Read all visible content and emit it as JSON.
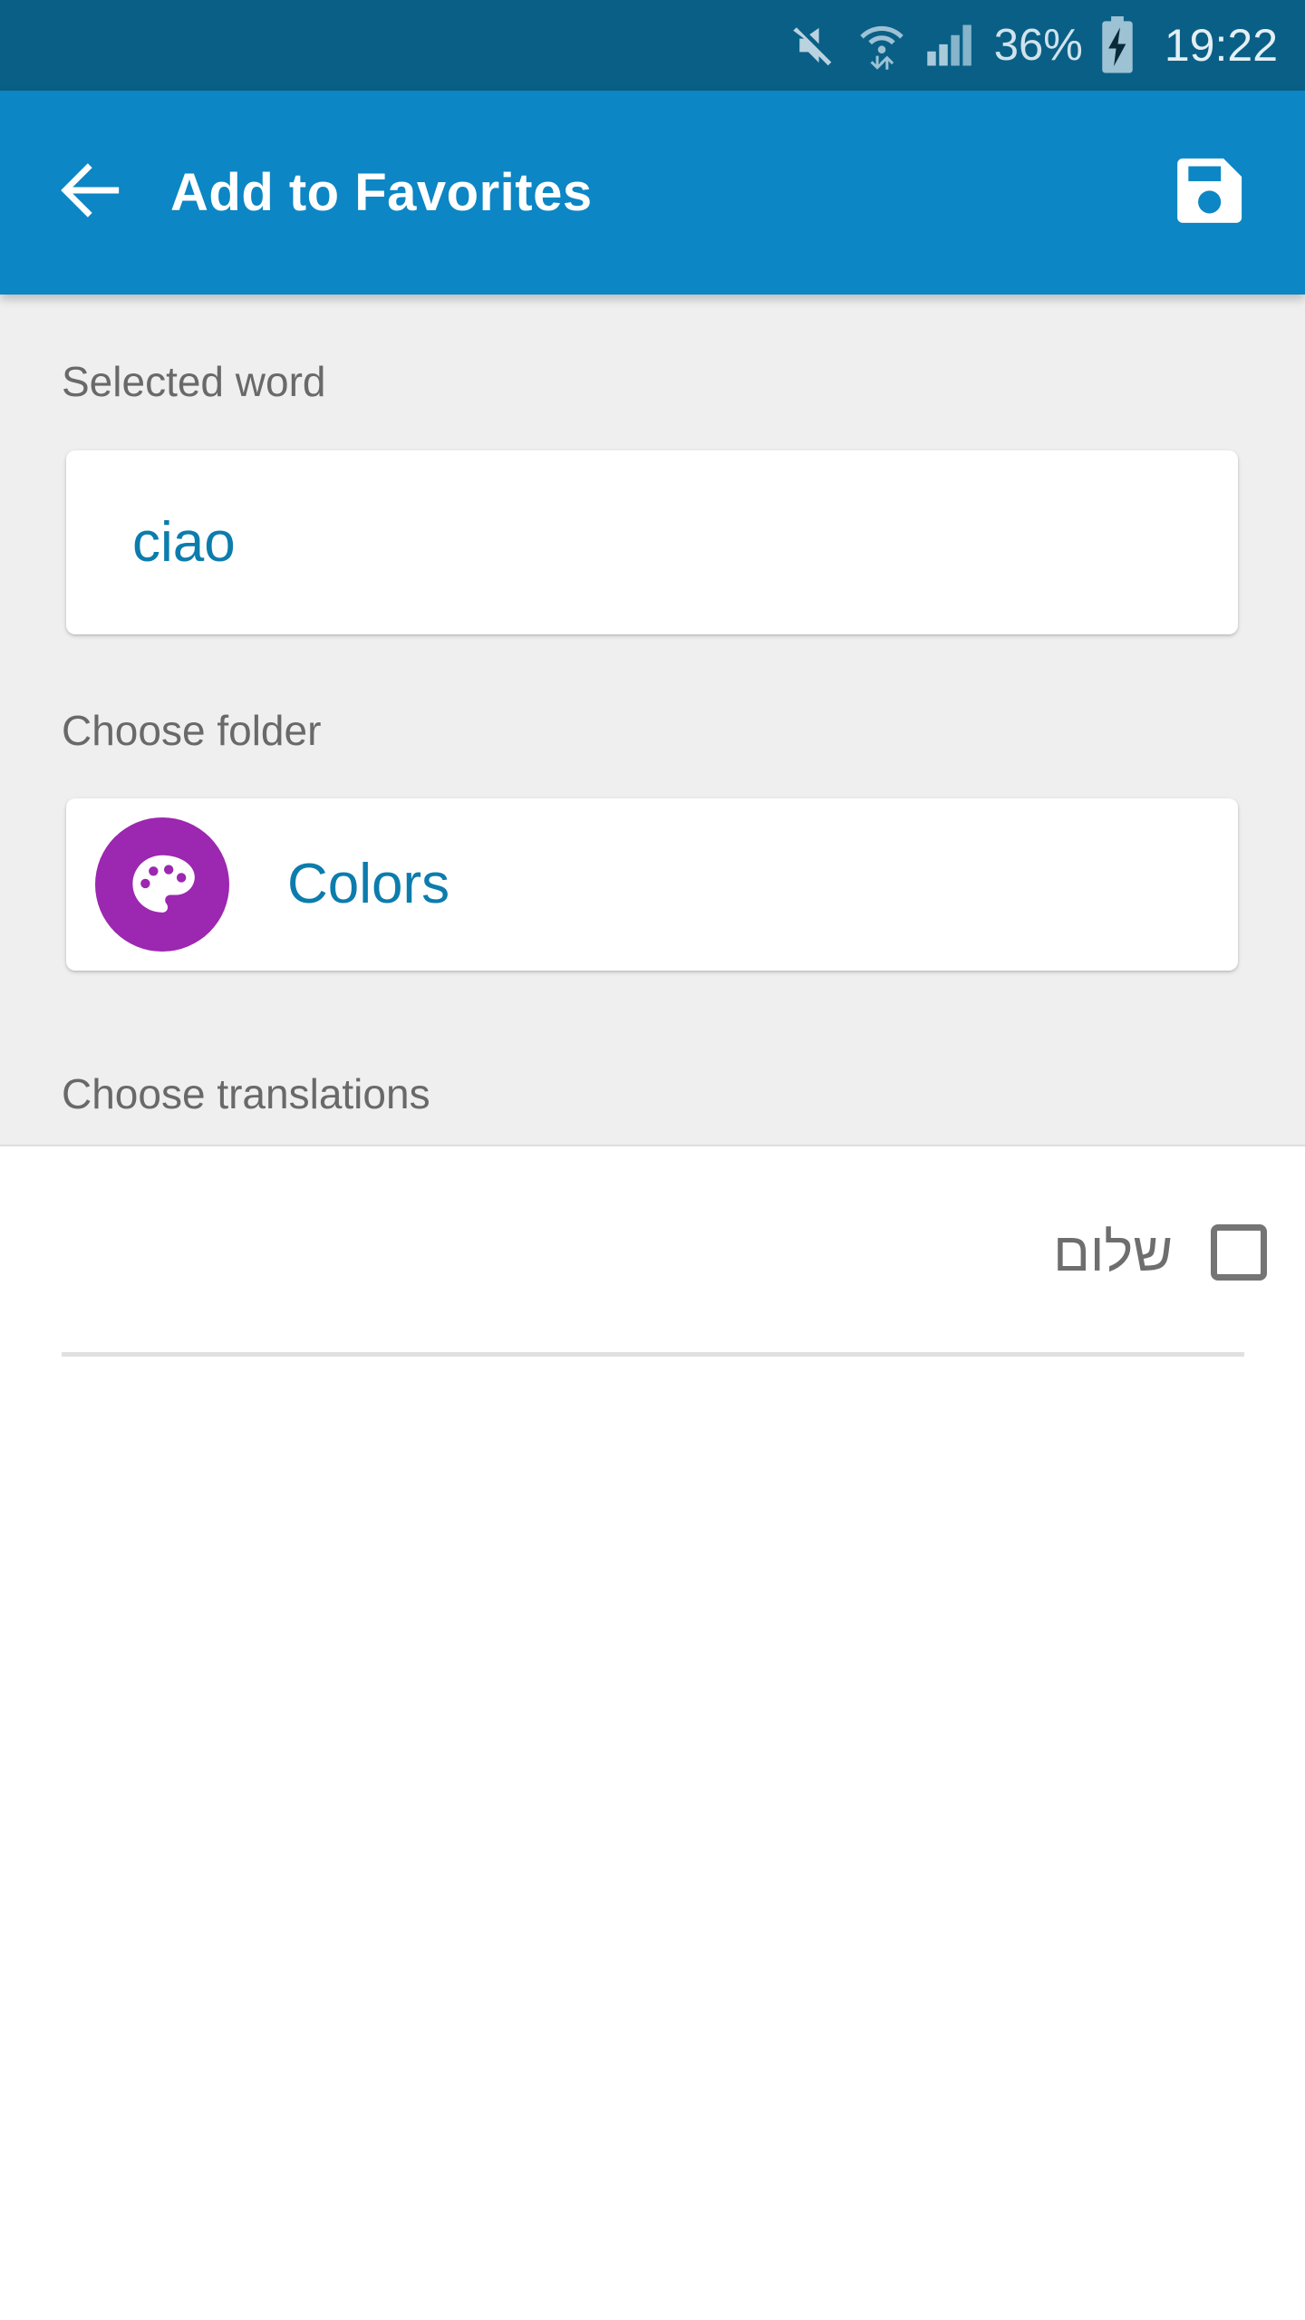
{
  "status_bar": {
    "background_color": "#0a5f86",
    "icons": [
      "mute-icon",
      "wifi-icon",
      "signal-icon"
    ],
    "battery_percent": "36%",
    "battery_state": "charging",
    "clock": "19:22"
  },
  "app_bar": {
    "background_color": "#0c86c4",
    "back_label": "Back",
    "title": "Add to Favorites",
    "save_label": "Save"
  },
  "form": {
    "selected_word": {
      "label": "Selected word",
      "value": "ciao",
      "value_color": "#0c7cad"
    },
    "choose_folder": {
      "label": "Choose folder",
      "folder_name": "Colors",
      "folder_icon": "palette-icon",
      "folder_icon_color": "#9c27b0",
      "folder_name_color": "#0c7cad"
    },
    "choose_translations": {
      "label": "Choose translations",
      "items": [
        {
          "text": "שלום",
          "checked": false
        }
      ]
    }
  }
}
